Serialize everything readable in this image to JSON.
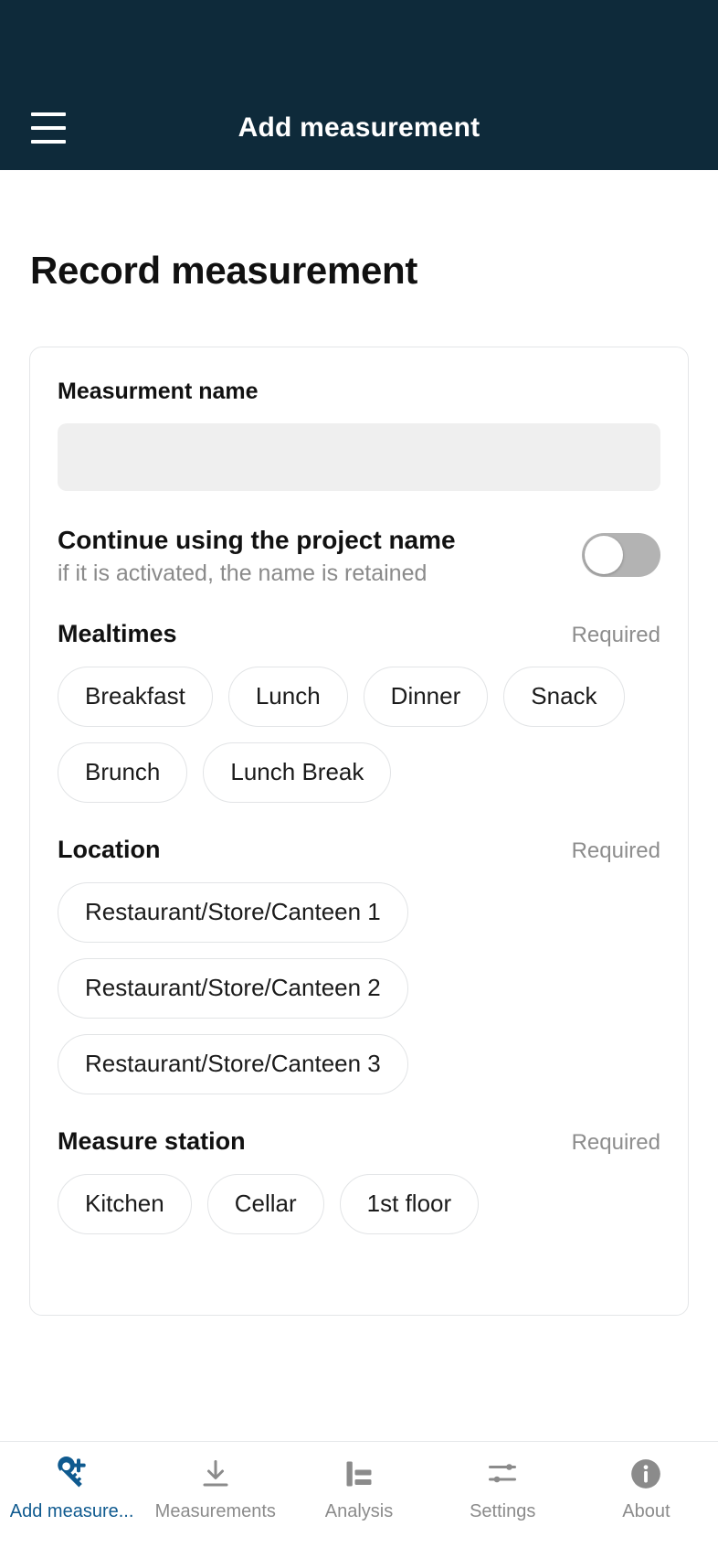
{
  "appbar": {
    "title": "Add measurement",
    "menu_icon": "hamburger-menu-icon",
    "bg_color": "#0e2a3a"
  },
  "page": {
    "title": "Record measurement"
  },
  "form": {
    "name_field": {
      "label": "Measurment name",
      "value": "",
      "placeholder": ""
    },
    "project_name_toggle": {
      "title": "Continue using the project name",
      "subtitle": "if it is activated, the name is retained",
      "state": "off"
    },
    "sections": [
      {
        "title": "Mealtimes",
        "required_label": "Required",
        "layout": "wrap",
        "options": [
          {
            "label": "Breakfast",
            "selected": false
          },
          {
            "label": "Lunch",
            "selected": false
          },
          {
            "label": "Dinner",
            "selected": false
          },
          {
            "label": "Snack",
            "selected": false
          },
          {
            "label": "Brunch",
            "selected": false
          },
          {
            "label": "Lunch Break",
            "selected": false
          }
        ]
      },
      {
        "title": "Location",
        "required_label": "Required",
        "layout": "stacked",
        "options": [
          {
            "label": "Restaurant/Store/Canteen 1",
            "selected": false
          },
          {
            "label": "Restaurant/Store/Canteen 2",
            "selected": false
          },
          {
            "label": "Restaurant/Store/Canteen 3",
            "selected": false
          }
        ]
      },
      {
        "title": "Measure station",
        "required_label": "Required",
        "layout": "wrap",
        "options": [
          {
            "label": "Kitchen",
            "selected": false
          },
          {
            "label": "Cellar",
            "selected": false
          },
          {
            "label": "1st floor",
            "selected": false
          }
        ]
      }
    ]
  },
  "bottom_nav": {
    "active_index": 0,
    "active_color": "#0f5a8f",
    "inactive_color": "#8b8b8b",
    "items": [
      {
        "label": "Add measure...",
        "icon": "add-measurement-icon"
      },
      {
        "label": "Measurements",
        "icon": "download-icon"
      },
      {
        "label": "Analysis",
        "icon": "bar-chart-icon"
      },
      {
        "label": "Settings",
        "icon": "sliders-icon"
      },
      {
        "label": "About",
        "icon": "info-circle-icon"
      }
    ]
  }
}
